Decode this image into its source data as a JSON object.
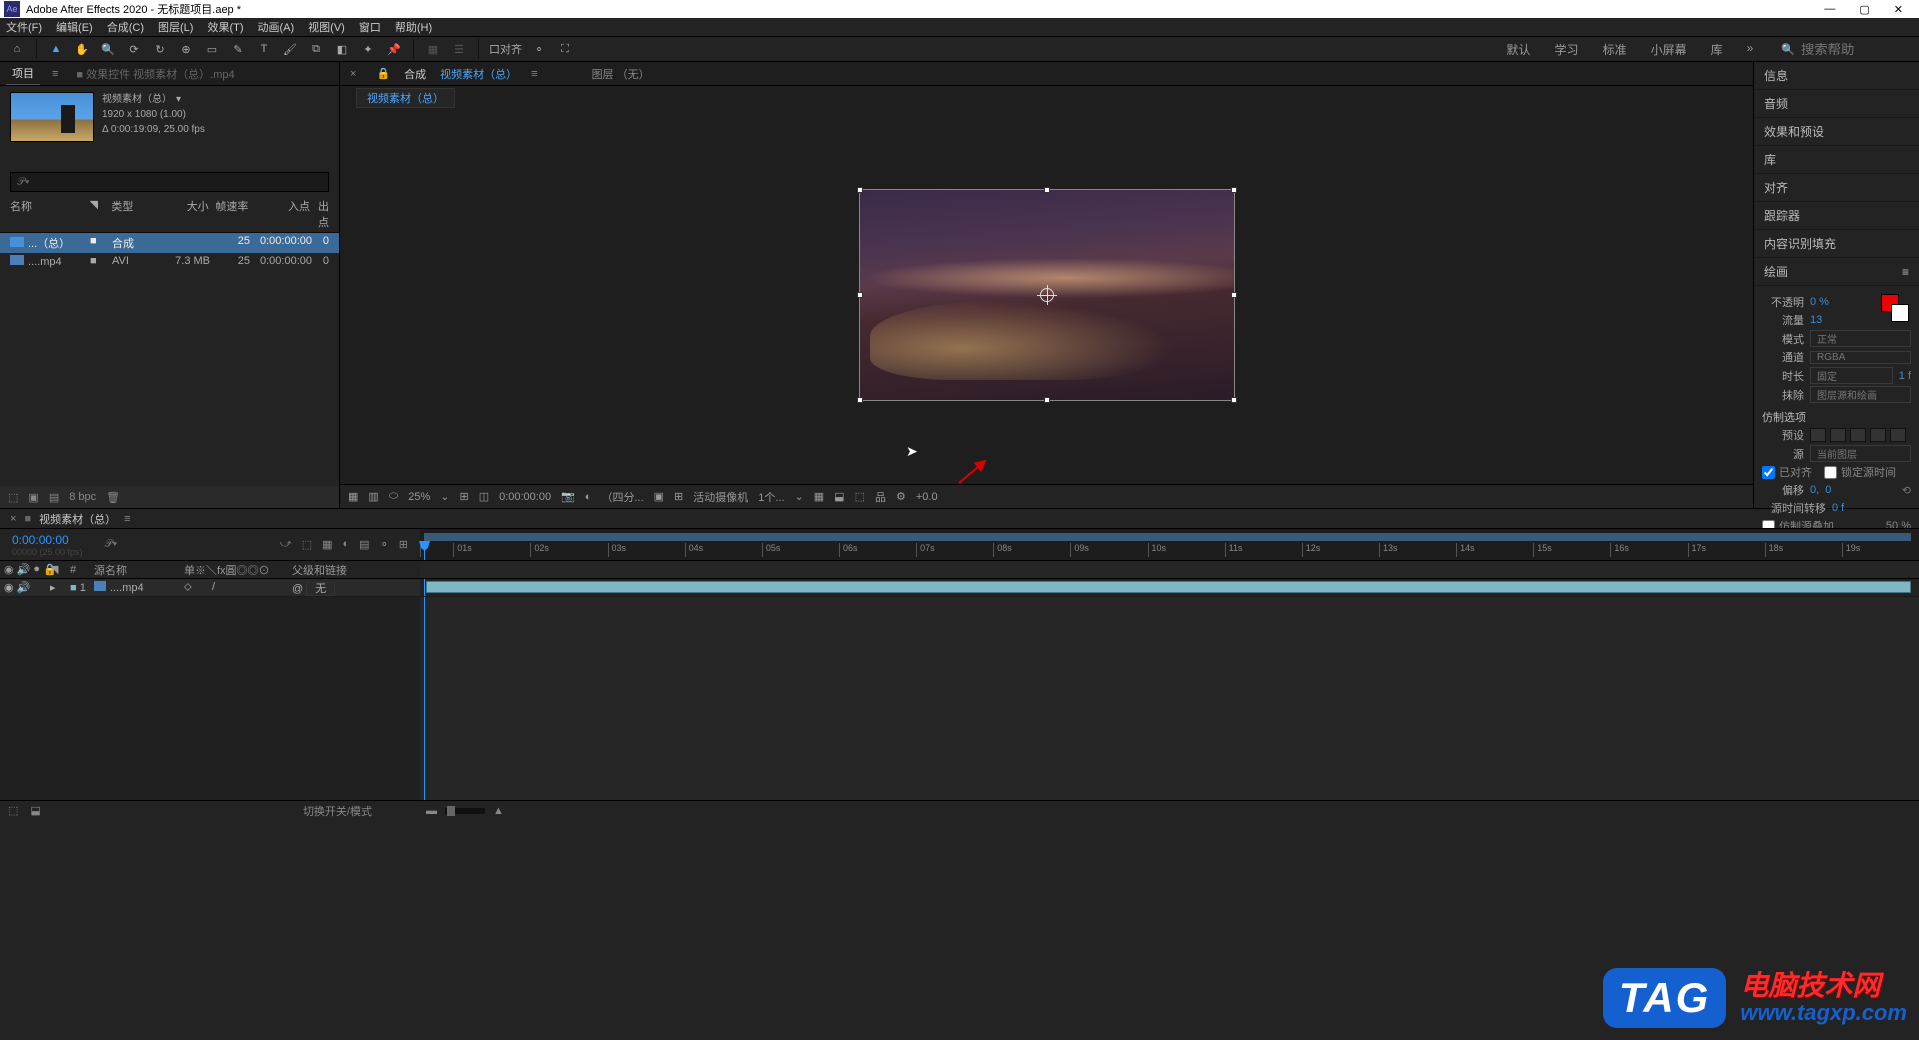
{
  "title": "Adobe After Effects 2020 - 无标题项目.aep *",
  "menu": [
    "文件(F)",
    "编辑(E)",
    "合成(C)",
    "图层(L)",
    "效果(T)",
    "动画(A)",
    "视图(V)",
    "窗口",
    "帮助(H)"
  ],
  "toolbar": {
    "snap": "口对齐"
  },
  "workspaces": [
    "默认",
    "学习",
    "标准",
    "小屏幕",
    "库"
  ],
  "search_placeholder": "搜索帮助",
  "project": {
    "tab_project": "项目",
    "tab_effects": "效果控件 视频素材（总）.mp4",
    "comp_name": "视频素材（总）",
    "dims": "1920 x 1080 (1.00)",
    "duration": "Δ 0:00:19:09, 25.00 fps",
    "cols": {
      "name": "名称",
      "type": "类型",
      "size": "大小",
      "fps": "帧速率",
      "in": "入点",
      "out": "出点"
    },
    "rows": [
      {
        "name": "...（总）",
        "type": "合成",
        "size": "",
        "fps": "25",
        "in": "0:00:00:00",
        "out": "0"
      },
      {
        "name": "....mp4",
        "type": "AVI",
        "size": "7.3 MB",
        "fps": "25",
        "in": "0:00:00:00",
        "out": "0"
      }
    ],
    "bpc": "8 bpc"
  },
  "comp": {
    "tab_prefix": "合成",
    "tab_name": "视频素材（总）",
    "layer_none": "图层 （无）",
    "flow_name": "视频素材（总）",
    "footer": {
      "zoom": "25%",
      "timecode": "0:00:00:00",
      "res": "（四分...",
      "camera": "活动摄像机",
      "views": "1个...",
      "exposure": "+0.0"
    }
  },
  "right": {
    "items": [
      "信息",
      "音频",
      "效果和预设",
      "库",
      "对齐",
      "跟踪器",
      "内容识别填充"
    ],
    "paint_header": "绘画",
    "opacity_l": "不透明",
    "opacity_v": "0 %",
    "flow_l": "流量",
    "flow_v": "13",
    "mode_l": "模式",
    "mode_v": "正常",
    "channel_l": "通道",
    "channel_v": "RGBA",
    "dur_l": "时长",
    "dur_v": "固定",
    "dur_f": "1 f",
    "erase_l": "抹除",
    "erase_v": "图层源和绘画",
    "clone_header": "仿制选项",
    "preset_l": "预设",
    "source_l": "源",
    "source_v": "当前图层",
    "aligned": "已对齐",
    "locksrc": "锁定源时间",
    "offset_l": "偏移",
    "offset_x": "0,",
    "offset_y": "0",
    "srctime_l": "源时间转移",
    "srctime_v": "0 f",
    "overlay": "仿制源叠加",
    "overlay_v": "50 %"
  },
  "timeline": {
    "tab": "视频素材（总）",
    "time": "0:00:00:00",
    "frames": "00000 (25.00 fps)",
    "cols": {
      "src": "源名称",
      "parent": "父级和链接"
    },
    "switches": "单※＼fx圓◎◎⊙",
    "layer1": {
      "num": "1",
      "name": "....mp4",
      "parent_sel": "无"
    },
    "ticks": [
      "01s",
      "02s",
      "03s",
      "04s",
      "05s",
      "06s",
      "07s",
      "08s",
      "09s",
      "10s",
      "11s",
      "12s",
      "13s",
      "14s",
      "15s",
      "16s",
      "17s",
      "18s",
      "19s"
    ],
    "footer": "切换开关/模式"
  },
  "watermark": {
    "tag": "TAG",
    "line1": "电脑技术网",
    "url": "www.tagxp.com"
  }
}
